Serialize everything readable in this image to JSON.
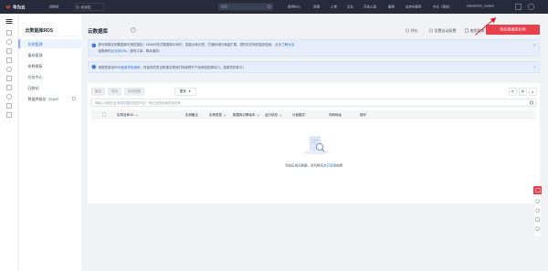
{
  "topbar": {
    "brand": "华为云",
    "console": "控制台",
    "region": "北京四",
    "search_placeholder": "搜索",
    "links": [
      "费用中心",
      "资源",
      "工单",
      "企业",
      "开发工具",
      "备案",
      "支持与服务",
      "中文（简体）",
      "stewartzho_huawei"
    ]
  },
  "sidebar": {
    "title": "云数据库RDS",
    "items": [
      {
        "label": "实例管理",
        "active": true
      },
      {
        "label": "备份管理",
        "active": false
      },
      {
        "label": "参数模板",
        "active": false
      },
      {
        "label": "任务中心",
        "active": false
      },
      {
        "label": "回收站",
        "active": false
      },
      {
        "label": "数据库服务（DAS）",
        "active": false,
        "external": true
      }
    ]
  },
  "header": {
    "title": "云数据库",
    "eval_label": "评价",
    "auto_renew_label": "设置自动续费",
    "guide_label": "使用指南",
    "buy_label": "购买数据库实例"
  },
  "banners": [
    {
      "line1_prefix": "即可获取实例数据库可用性报告！DDM分布式数据库中间件，智能分库分表，打通存储与海量扩展，提供非关系的高效检索，点击了",
      "line1_link": "解对话",
      "line2_prefix": "我推荐的",
      "line2_link": "支业务DRs",
      "line2_suffix": "，我的订单，降本增效!"
    },
    {
      "text_prefix": "诚邀您参加RDS",
      "text_link": "使用体验调研",
      "text_suffix": "，您宝贵的意见和建议是我们持续提升产品体验的源动力，感谢您的参与！"
    }
  ],
  "toolbar": {
    "buttons": [
      "重启",
      "登录",
      "修改规格"
    ],
    "more_label": "更多",
    "search_placeholder": "请输入或者在此选择您要检索的内容，默认全部检索实例名称"
  },
  "table": {
    "columns": [
      "实例名称/ID",
      "实例备注",
      "实例类型",
      "数据库引擎版本",
      "运行状态",
      "计费模式",
      "内网地址",
      "操作"
    ]
  },
  "empty_state": {
    "text_prefix": "当前区域无数据，请切换至",
    "text_link": "其它资源",
    "text_suffix": "查看"
  },
  "colors": {
    "accent": "#2f6fde",
    "buy_button": "#e8404c",
    "topbar": "#252b3a",
    "annotation_arrow": "#e02020"
  }
}
